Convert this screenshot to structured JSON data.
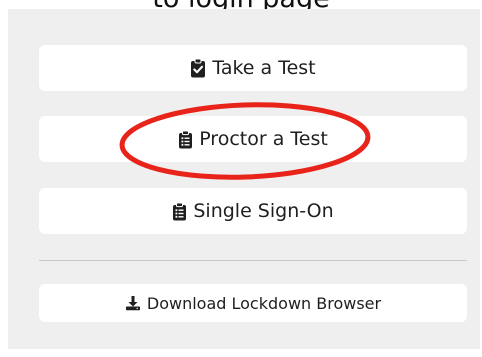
{
  "header": {
    "partial_title": "to login page"
  },
  "buttons": {
    "take_test": {
      "label": "Take a Test",
      "icon": "clipboard-check-icon"
    },
    "proctor_test": {
      "label": "Proctor a Test",
      "icon": "clipboard-list-icon"
    },
    "single_sign_on": {
      "label": "Single Sign-On",
      "icon": "clipboard-list-icon"
    },
    "download_lockdown": {
      "label": "Download Lockdown Browser",
      "icon": "download-icon"
    }
  },
  "colors": {
    "panel_background": "#efefef",
    "button_background": "#ffffff",
    "annotation_circle": "#e8231a"
  }
}
